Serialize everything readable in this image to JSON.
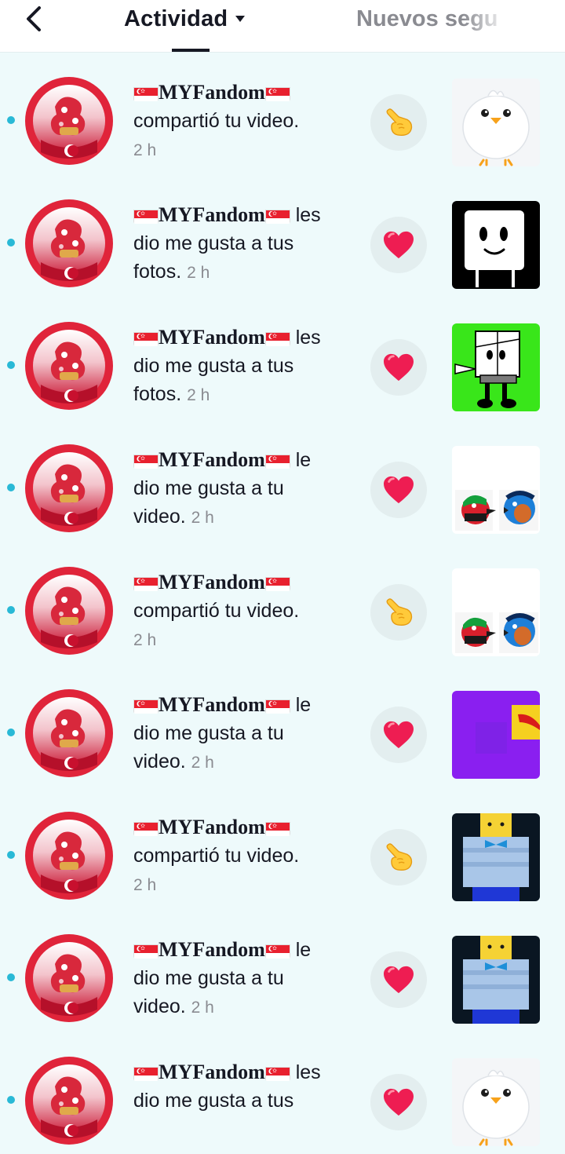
{
  "header": {
    "tab_active": "Actividad",
    "tab_other": "Nuevos segu"
  },
  "colors": {
    "unread_dot": "#29b9d6",
    "heart": "#ee1d52",
    "accent_dark": "#161823",
    "muted": "#8a8b91"
  },
  "notifications": [
    {
      "user": "MYFandom",
      "line1": "",
      "line2": "compartió tu video.",
      "line3": "",
      "time": "2 h",
      "action_icon": "pointing-hand",
      "thumb": "white-chick"
    },
    {
      "user": "MYFandom",
      "line1": "les",
      "line2": "dio me gusta a tus",
      "line3": "fotos.",
      "time": "2 h",
      "action_icon": "heart",
      "thumb": "black-box-face"
    },
    {
      "user": "MYFandom",
      "line1": "les",
      "line2": "dio me gusta a tus",
      "line3": "fotos.",
      "time": "2 h",
      "action_icon": "heart",
      "thumb": "green-paper-character"
    },
    {
      "user": "MYFandom",
      "line1": "le",
      "line2": "dio me gusta a tu",
      "line3": "video.",
      "time": "2 h",
      "action_icon": "heart",
      "thumb": "two-birds"
    },
    {
      "user": "MYFandom",
      "line1": "",
      "line2": "compartió tu video.",
      "line3": "",
      "time": "2 h",
      "action_icon": "pointing-hand",
      "thumb": "two-birds"
    },
    {
      "user": "MYFandom",
      "line1": "le",
      "line2": "dio me gusta a tu",
      "line3": "video.",
      "time": "2 h",
      "action_icon": "heart",
      "thumb": "purple-square"
    },
    {
      "user": "MYFandom",
      "line1": "",
      "line2": "compartió tu video.",
      "line3": "",
      "time": "2 h",
      "action_icon": "pointing-hand",
      "thumb": "blocky-figure"
    },
    {
      "user": "MYFandom",
      "line1": "le",
      "line2": "dio me gusta a tu",
      "line3": "video.",
      "time": "2 h",
      "action_icon": "heart",
      "thumb": "blocky-figure"
    },
    {
      "user": "MYFandom",
      "line1": "les",
      "line2": "dio me gusta a tus",
      "line3": "",
      "time": "",
      "action_icon": "heart",
      "thumb": "white-chick"
    }
  ]
}
